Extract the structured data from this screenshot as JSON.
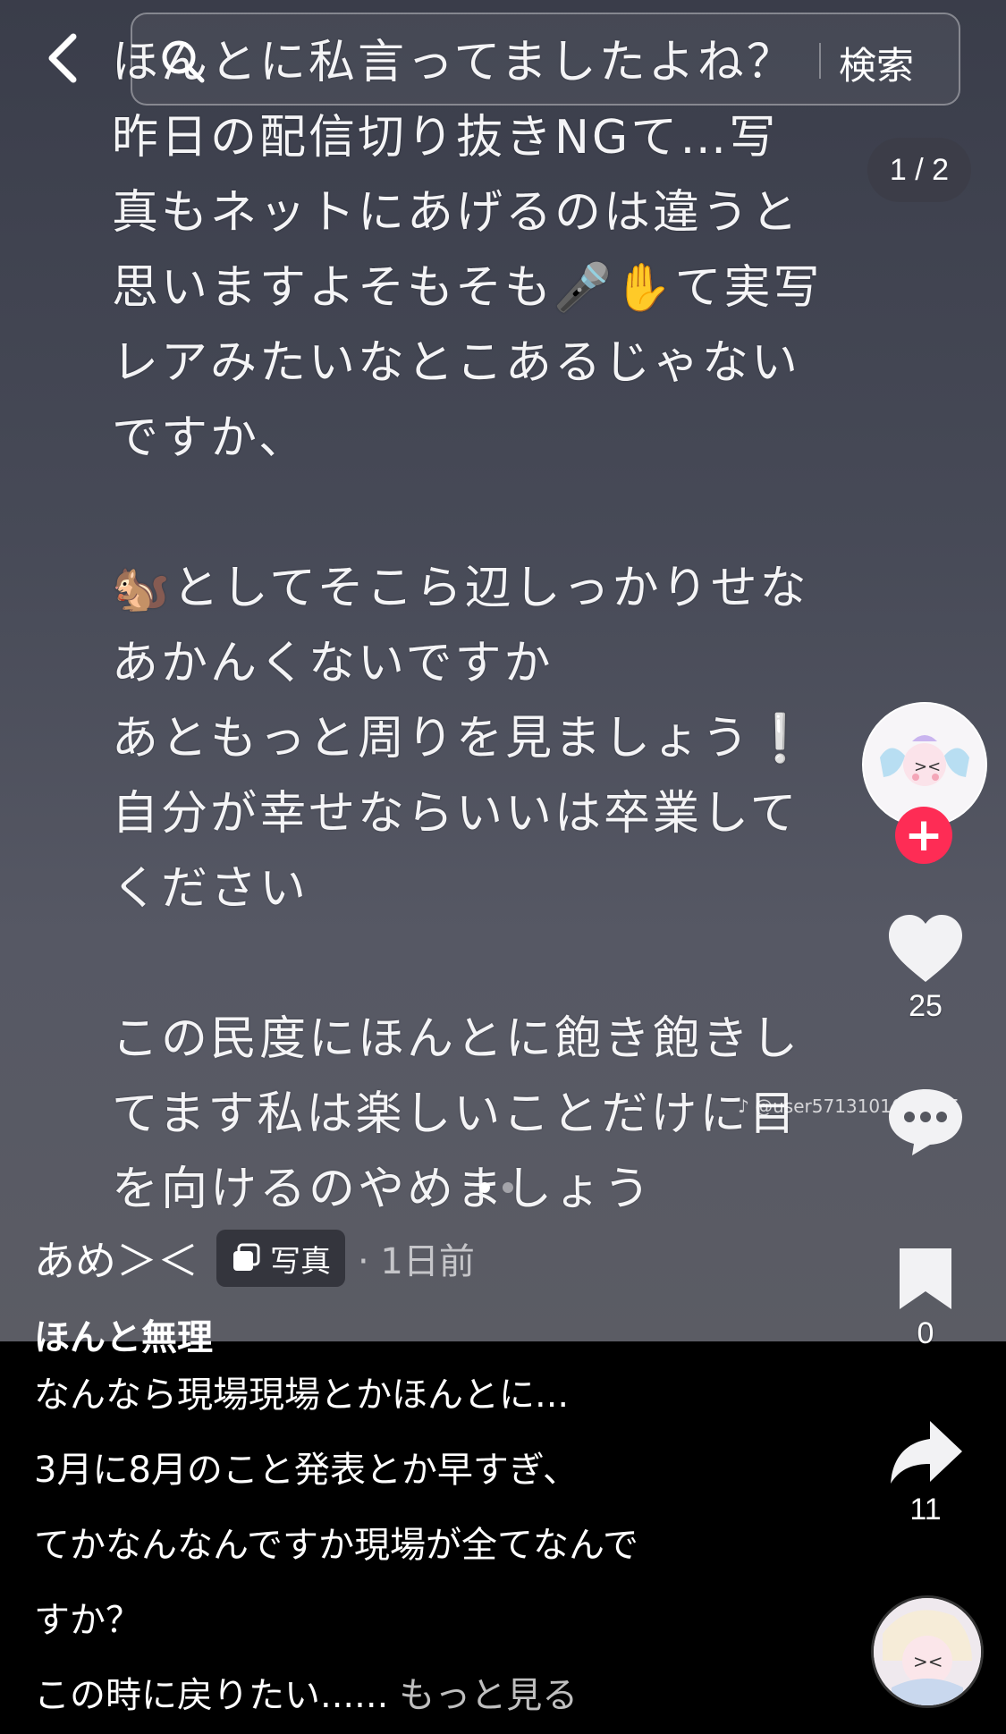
{
  "search": {
    "overlay_text": "ほんとに私言ってましたよね？",
    "button_label": "検索"
  },
  "photo": {
    "counter": "1 / 2",
    "text": "ほんとに私言ってましたよね？\n昨日の配信切り抜きNGて…写\n真もネットにあげるのは違うと\n思いますよそもそも🎤✋て実写\nレアみたいなとこあるじゃない\nですか、\n\n🐿️としてそこら辺しっかりせな\nあかんくないですか\nあともっと周りを見ましょう❕\n自分が幸せならいいは卒業して\nください\n\nこの民度にほんとに飽き飽きし\nてます私は楽しいことだけに目\nを向けるのやめましょう",
    "watermark": "♪ @user5713101624035",
    "slide_count": 2,
    "active_slide": 1
  },
  "sidebar": {
    "like_count": "25",
    "comment_count": "",
    "bookmark_count": "0",
    "share_count": "11"
  },
  "post": {
    "author": "あめ＞＜",
    "type_badge": "写真",
    "time": "· 1日前",
    "title": "ほんと無理",
    "caption_lines": [
      "なんなら現場現場とかほんとに...",
      "3月に8月のこと発表とか早すぎ、",
      "てかなんなんですか現場が全てなんで",
      "すか？",
      "この時に戻りたい......"
    ],
    "more_label": "もっと見る"
  },
  "colors": {
    "follow": "#fe2c55",
    "background": "#000000"
  },
  "icons": [
    "back-arrow-icon",
    "search-icon",
    "plus-icon",
    "heart-icon",
    "comment-icon",
    "bookmark-icon",
    "share-icon",
    "photo-stack-icon",
    "music-disc-icon"
  ]
}
